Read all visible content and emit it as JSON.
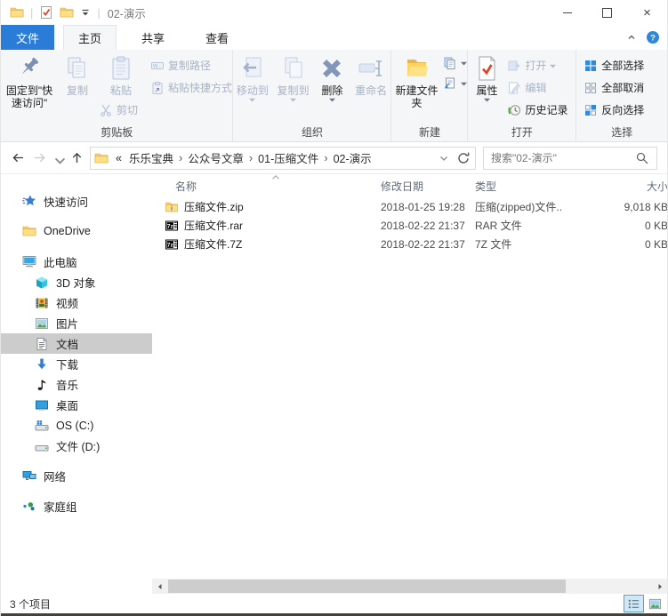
{
  "window": {
    "title": "02-演示"
  },
  "tabs": {
    "file": "文件",
    "home": "主页",
    "share": "共享",
    "view": "查看"
  },
  "ribbon": {
    "clipboard": {
      "label": "剪贴板",
      "pin": "固定到\"快速访问\"",
      "copy": "复制",
      "paste": "粘贴",
      "cut": "剪切",
      "copy_path": "复制路径",
      "paste_shortcut": "粘贴快捷方式"
    },
    "organize": {
      "label": "组织",
      "move_to": "移动到",
      "copy_to": "复制到",
      "delete": "删除",
      "rename": "重命名"
    },
    "new": {
      "label": "新建",
      "new_folder": "新建文件夹"
    },
    "open": {
      "label": "打开",
      "properties": "属性",
      "open": "打开",
      "edit": "编辑",
      "history": "历史记录"
    },
    "select": {
      "label": "选择",
      "select_all": "全部选择",
      "select_none": "全部取消",
      "invert": "反向选择"
    }
  },
  "address": {
    "overflow": "«",
    "crumbs": [
      "乐乐宝典",
      "公众号文章",
      "01-压缩文件",
      "02-演示"
    ]
  },
  "search": {
    "placeholder": "搜索\"02-演示\""
  },
  "sidebar": {
    "items": [
      {
        "label": "快速访问",
        "icon": "quick-access-icon",
        "level": 0,
        "selected": false
      },
      {
        "label": "OneDrive",
        "icon": "onedrive-folder-icon",
        "level": 0,
        "selected": false
      },
      {
        "label": "此电脑",
        "icon": "this-pc-icon",
        "level": 0,
        "selected": false
      },
      {
        "label": "3D 对象",
        "icon": "3d-objects-icon",
        "level": 1,
        "selected": false
      },
      {
        "label": "视频",
        "icon": "videos-icon",
        "level": 1,
        "selected": false
      },
      {
        "label": "图片",
        "icon": "pictures-icon",
        "level": 1,
        "selected": false
      },
      {
        "label": "文档",
        "icon": "documents-icon",
        "level": 1,
        "selected": true
      },
      {
        "label": "下载",
        "icon": "downloads-icon",
        "level": 1,
        "selected": false
      },
      {
        "label": "音乐",
        "icon": "music-icon",
        "level": 1,
        "selected": false
      },
      {
        "label": "桌面",
        "icon": "desktop-icon",
        "level": 1,
        "selected": false
      },
      {
        "label": "OS (C:)",
        "icon": "os-drive-icon",
        "level": 1,
        "selected": false
      },
      {
        "label": "文件 (D:)",
        "icon": "data-drive-icon",
        "level": 1,
        "selected": false
      },
      {
        "label": "网络",
        "icon": "network-icon",
        "level": 0,
        "selected": false
      },
      {
        "label": "家庭组",
        "icon": "homegroup-icon",
        "level": 0,
        "selected": false
      }
    ]
  },
  "files": {
    "columns": [
      {
        "label": "名称"
      },
      {
        "label": "修改日期"
      },
      {
        "label": "类型"
      },
      {
        "label": "大小"
      }
    ],
    "rows": [
      {
        "name": "压缩文件.zip",
        "date": "2018-01-25 19:28",
        "type": "压缩(zipped)文件...",
        "size": "9,018 KB",
        "icon": "zip-file-icon"
      },
      {
        "name": "压缩文件.rar",
        "date": "2018-02-22 21:37",
        "type": "RAR 文件",
        "size": "0 KB",
        "icon": "7z-file-icon"
      },
      {
        "name": "压缩文件.7Z",
        "date": "2018-02-22 21:37",
        "type": "7Z 文件",
        "size": "0 KB",
        "icon": "7z-file-icon"
      }
    ]
  },
  "statusbar": {
    "count": "3 个项目"
  }
}
